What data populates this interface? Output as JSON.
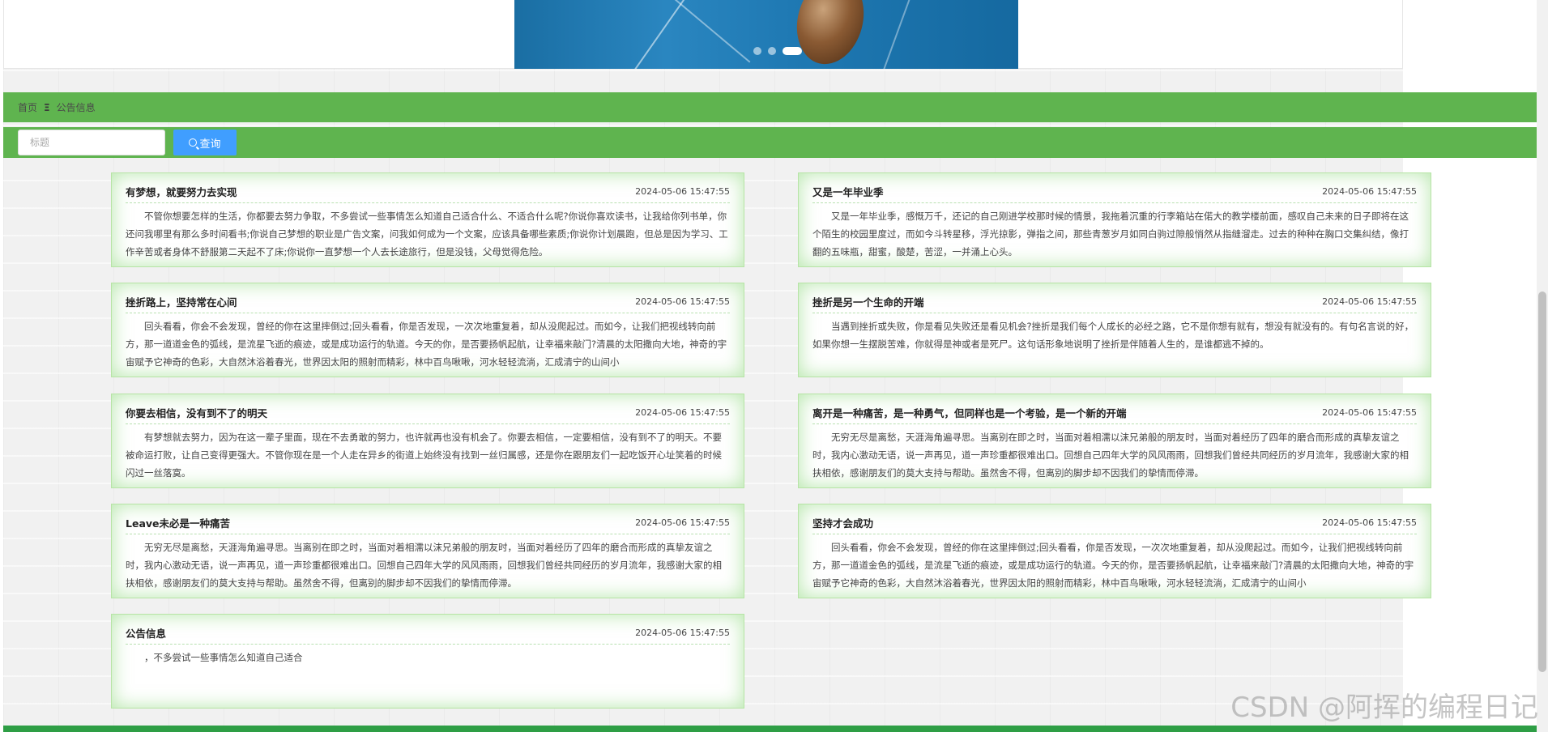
{
  "breadcrumb": {
    "home": "首页",
    "separator": "Ξ",
    "current": "公告信息"
  },
  "search": {
    "placeholder": "标题",
    "button_label": "查询"
  },
  "notices": [
    {
      "title": "有梦想，就要努力去实现",
      "time": "2024-05-06 15:47:55",
      "content": "不管你想要怎样的生活，你都要去努力争取，不多尝试一些事情怎么知道自己适合什么、不适合什么呢?你说你喜欢读书，让我给你列书单，你还问我哪里有那么多时间看书;你说自己梦想的职业是广告文案，问我如何成为一个文案，应该具备哪些素质;你说你计划晨跑，但总是因为学习、工作辛苦或者身体不舒服第二天起不了床;你说你一直梦想一个人去长途旅行，但是没钱，父母觉得危险。"
    },
    {
      "title": "又是一年毕业季",
      "time": "2024-05-06 15:47:55",
      "content": "又是一年毕业季，感慨万千，还记的自己刚进学校那时候的情景，我拖着沉重的行李箱站在偌大的教学楼前面，感叹自己未来的日子即将在这个陌生的校园里度过，而如今斗转星移，浮光掠影，弹指之间，那些青葱岁月如同白驹过隙般悄然从指缝溜走。过去的种种在胸口交集纠结，像打翻的五味瓶，甜蜜，酸楚，苦涩，一并涌上心头。"
    },
    {
      "title": "挫折路上，坚持常在心间",
      "time": "2024-05-06 15:47:55",
      "content": "回头看看，你会不会发现，曾经的你在这里摔倒过;回头看看，你是否发现，一次次地重复着，却从没爬起过。而如今，让我们把视线转向前方，那一道道金色的弧线，是流星飞逝的痕迹，或是成功运行的轨道。今天的你，是否要扬帆起航，让幸福来敲门?清晨的太阳撒向大地，神奇的宇宙赋予它神奇的色彩，大自然沐浴着春光，世界因太阳的照射而精彩，林中百鸟啾啾，河水轻轻流淌，汇成清宁的山间小"
    },
    {
      "title": "挫折是另一个生命的开端",
      "time": "2024-05-06 15:47:55",
      "content": "当遇到挫折或失败，你是看见失败还是看见机会?挫折是我们每个人成长的必经之路，它不是你想有就有，想没有就没有的。有句名言说的好，如果你想一生摆脱苦难，你就得是神或者是死尸。这句话形象地说明了挫折是伴随着人生的，是谁都逃不掉的。"
    },
    {
      "title": "你要去相信，没有到不了的明天",
      "time": "2024-05-06 15:47:55",
      "content": "有梦想就去努力，因为在这一辈子里面，现在不去勇敢的努力，也许就再也没有机会了。你要去相信，一定要相信，没有到不了的明天。不要被命运打败，让自己变得更强大。不管你现在是一个人走在异乡的街道上始终没有找到一丝归属感，还是你在跟朋友们一起吃饭开心址笑着的时候闪过一丝落寞。"
    },
    {
      "title": "离开是一种痛苦，是一种勇气，但同样也是一个考验，是一个新的开端",
      "time": "2024-05-06 15:47:55",
      "content": "无穷无尽是离愁，天涯海角遍寻思。当离别在即之时，当面对着相濡以沫兄弟般的朋友时，当面对着经历了四年的磨合而形成的真挚友谊之时，我内心激动无语，说一声再见，道一声珍重都很难出口。回想自己四年大学的风风雨雨，回想我们曾经共同经历的岁月流年，我感谢大家的相扶相依，感谢朋友们的莫大支持与帮助。虽然舍不得，但离别的脚步却不因我们的挚情而停滞。"
    },
    {
      "title": "Leave未必是一种痛苦",
      "time": "2024-05-06 15:47:55",
      "content": "无穷无尽是离愁，天涯海角遍寻思。当离别在即之时，当面对着相濡以沫兄弟般的朋友时，当面对着经历了四年的磨合而形成的真挚友谊之时，我内心激动无语，说一声再见，道一声珍重都很难出口。回想自己四年大学的风风雨雨，回想我们曾经共同经历的岁月流年，我感谢大家的相扶相依，感谢朋友们的莫大支持与帮助。虽然舍不得，但离别的脚步却不因我们的挚情而停滞。"
    },
    {
      "title": "坚持才会成功",
      "time": "2024-05-06 15:47:55",
      "content": "回头看看，你会不会发现，曾经的你在这里摔倒过;回头看看，你是否发现，一次次地重复着，却从没爬起过。而如今，让我们把视线转向前方，那一道道金色的弧线，是流星飞逝的痕迹，或是成功运行的轨道。今天的你，是否要扬帆起航，让幸福来敲门?清晨的太阳撒向大地，神奇的宇宙赋予它神奇的色彩，大自然沐浴着春光，世界因太阳的照射而精彩，林中百鸟啾啾，河水轻轻流淌，汇成清宁的山间小"
    },
    {
      "title": "公告信息",
      "time": "2024-05-06 15:47:55",
      "content": "，不多尝试一些事情怎么知道自己适合"
    }
  ],
  "carousel": {
    "slide_count": 3,
    "active_index": 2
  },
  "watermark": "CSDN @阿挥的编程日记",
  "colors": {
    "bar_green": "#5fb44f",
    "button_blue": "#409eff",
    "card_glow": "#b6e4a5",
    "footer_green": "#2e9e45"
  }
}
